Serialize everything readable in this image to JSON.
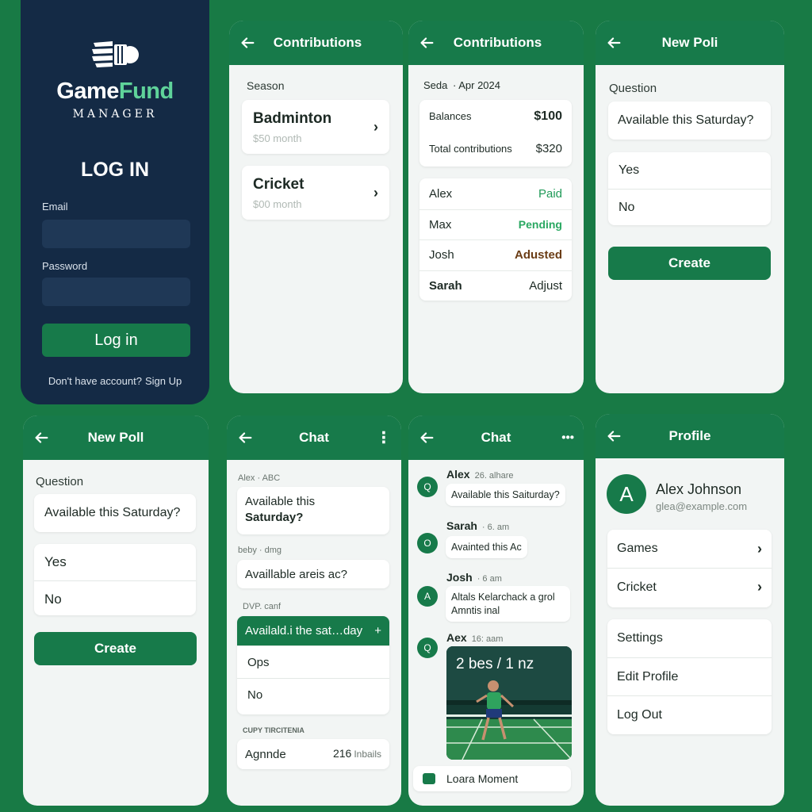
{
  "colors": {
    "background": "#187a45",
    "header": "#177a4a",
    "login_bg": "#142a45",
    "accent": "#5fd39a"
  },
  "login": {
    "logo_word1": "Game",
    "logo_word2": "Fund",
    "logo_sub": "MANAGER",
    "title": "LOG IN",
    "email_label": "Email",
    "password_label": "Password",
    "button": "Log in",
    "no_account": "Don't have account?",
    "signup": "Sign Up"
  },
  "contrib1": {
    "title": "Contributions",
    "section": "Season",
    "items": [
      {
        "name": "Badminton",
        "sub": "$50 month"
      },
      {
        "name": "Cricket",
        "sub": "$00 month"
      }
    ]
  },
  "contrib2": {
    "title": "Contributions",
    "season_name": "Seda",
    "season_date": "· Apr 2024",
    "balances_label": "Balances",
    "balances_value": "$100",
    "total_label": "Total contributions",
    "total_value": "$320",
    "payments": [
      {
        "name": "Alex",
        "status": "Paid"
      },
      {
        "name": "Max",
        "status": "Pending"
      },
      {
        "name": "Josh",
        "status": "Adusted"
      },
      {
        "name": "Sarah",
        "status": "Adjust"
      }
    ]
  },
  "poll1": {
    "title": "New Poli",
    "question_label": "Question",
    "question": "Available this Saturday?",
    "options": [
      "Yes",
      "No"
    ],
    "create": "Create"
  },
  "poll2": {
    "title": "New Poll",
    "question_label": "Question",
    "question": "Available this Saturday?",
    "options": [
      "Yes",
      "No"
    ],
    "create": "Create"
  },
  "chat1": {
    "title": "Chat",
    "more": "⋮",
    "msg1_meta": "Alex · ABC",
    "msg1_line1": "Available this",
    "msg1_line2": "Saturday?",
    "msg2_meta": "beby · dmg",
    "msg2_text": "Availlable areis ac?",
    "poll_meta": "DVP. canf",
    "poll_header": "Availald.i the sat…day",
    "poll_header_icon": "+",
    "poll_options": [
      "Ops",
      "No"
    ],
    "section2": "CUPY TIRCITENIA",
    "agenda_label": "Agnnde",
    "agenda_value": "216",
    "agenda_suffix": "Inbails"
  },
  "chat2": {
    "title": "Chat",
    "more": "•••",
    "messages": [
      {
        "name": "Alex",
        "time": "26. alhare",
        "text": "Available this Saiturday?",
        "avatar": "Q"
      },
      {
        "name": "Sarah",
        "time": "· 6. am",
        "text": "Avainted this Ac",
        "avatar": "O"
      },
      {
        "name": "Josh",
        "time": "· 6 am",
        "text1": "Altals Kelarchack a grol",
        "text2": "Amntis inal",
        "avatar": "A"
      },
      {
        "name": "Aex",
        "time": "16: aam",
        "avatar": "Q"
      }
    ],
    "photo_score": "2 bes / 1 nz",
    "moment": "Loara Moment"
  },
  "profile": {
    "title": "Profile",
    "avatar_letter": "A",
    "name": "Alex Johnson",
    "email": "glea@example.com",
    "nav": [
      "Games",
      "Cricket"
    ],
    "actions": [
      "Settings",
      "Edit Profile",
      "Log Out"
    ]
  }
}
